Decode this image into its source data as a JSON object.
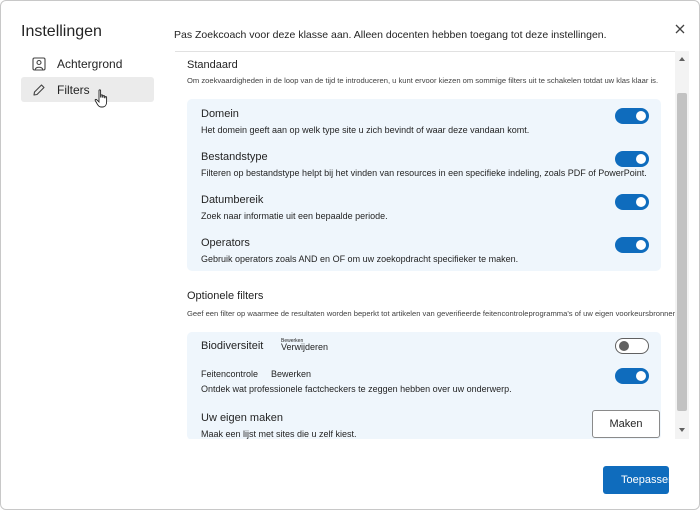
{
  "sidebar": {
    "title": "Instellingen",
    "items": [
      {
        "label": "Achtergrond",
        "icon": "image-icon"
      },
      {
        "label": "Filters",
        "icon": "pencil-icon"
      }
    ]
  },
  "header": {
    "intro": "Pas Zoekcoach voor deze klasse aan. Alleen docenten hebben toegang tot deze instellingen."
  },
  "standard": {
    "title": "Standaard",
    "description": "Om zoekvaardigheden in de loop van de tijd te introduceren, u kunt ervoor kiezen om sommige filters uit te schakelen totdat uw klas klaar is.",
    "items": [
      {
        "title": "Domein",
        "description": "Het domein geeft aan op welk type site u zich bevindt of waar deze vandaan komt.",
        "enabled": true
      },
      {
        "title": "Bestandstype",
        "description": "Filteren op bestandstype helpt bij het vinden van resources in een specifieke indeling, zoals PDF of PowerPoint.",
        "enabled": true
      },
      {
        "title": "Datumbereik",
        "description": "Zoek naar informatie uit een bepaalde periode.",
        "enabled": true
      },
      {
        "title": "Operators",
        "description": "Gebruik operators zoals AND en OF om uw zoekopdracht specifieker te maken.",
        "enabled": true
      }
    ]
  },
  "optional": {
    "title": "Optionele filters",
    "description": "Geef een filter op waarmee de resultaten worden beperkt tot artikelen van geverifieerde feitencontroleprogramma's of uw eigen voorkeursbronnen.",
    "biodiversity": {
      "title": "Biodiversiteit",
      "edit_label": "Bewerken",
      "remove_label": "Verwijderen",
      "enabled": false
    },
    "factcheck": {
      "title": "Feitencontrole",
      "edit_label": "Bewerken",
      "description": "Ontdek wat professionele factcheckers te zeggen hebben over uw onderwerp.",
      "enabled": true
    },
    "custom": {
      "title": "Uw eigen maken",
      "description": "Maak een lijst met sites die u zelf kiest.",
      "button_label": "Maken"
    }
  },
  "footer": {
    "apply_label": "Toepassen"
  },
  "colors": {
    "accent": "#0f6cbd",
    "card_bg": "#eff6fc"
  }
}
